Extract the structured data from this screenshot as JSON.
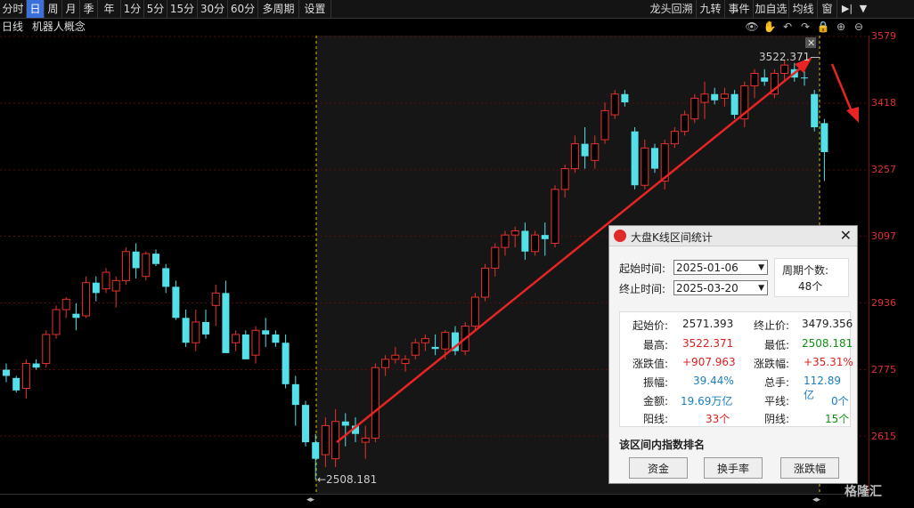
{
  "toolbar": {
    "periods": [
      "分时",
      "日",
      "周",
      "月",
      "季",
      "年",
      "1分",
      "5分",
      "15分",
      "30分",
      "60分",
      "多周期",
      "设置"
    ],
    "right_items": [
      "龙头回溯",
      "九转",
      "事件",
      "加自选",
      "均线",
      "窗"
    ]
  },
  "info": {
    "period": "日线",
    "name": "机器人概念"
  },
  "yaxis": {
    "labels": [
      "3579",
      "3418",
      "3257",
      "3097",
      "2936",
      "2775",
      "2615"
    ]
  },
  "markers": {
    "high": "3522.371",
    "low": "2508.181"
  },
  "stats": {
    "title": "大盘K线区间统计",
    "start_label": "起始时间:",
    "start_value": "2025-01-06",
    "end_label": "终止时间:",
    "end_value": "2025-03-20",
    "cycles_label": "周期个数:",
    "cycles_value": "48个",
    "open_label": "起始价:",
    "open_value": "2571.393",
    "close_label": "终止价:",
    "close_value": "3479.356",
    "high_label": "最高:",
    "high_value": "3522.371",
    "low_label": "最低:",
    "low_value": "2508.181",
    "chg_label": "涨跌值:",
    "chg_value": "+907.963",
    "pct_label": "涨跌幅:",
    "pct_value": "+35.31%",
    "amp_label": "振幅:",
    "amp_value": "39.44%",
    "vol_label": "总手:",
    "vol_value": "112.89亿",
    "amt_label": "金额:",
    "amt_value": "19.69万亿",
    "flat_label": "平线:",
    "flat_value": "0个",
    "up_label": "阳线:",
    "up_value": "33个",
    "down_label": "阴线:",
    "down_value": "15个",
    "rank_label": "该区间内指数排名",
    "buttons": [
      "资金",
      "换手率",
      "涨跌幅"
    ]
  },
  "brand": "格隆汇",
  "colors": {
    "up": "#e8322a",
    "down": "#54e0e8",
    "grid": "#5a0d0d",
    "line": "#e82424"
  },
  "candles": [
    [
      2775,
      2790,
      2745,
      2760
    ],
    [
      2755,
      2760,
      2720,
      2725
    ],
    [
      2730,
      2800,
      2705,
      2790
    ],
    [
      2790,
      2800,
      2775,
      2780
    ],
    [
      2790,
      2870,
      2780,
      2860
    ],
    [
      2860,
      2930,
      2850,
      2920
    ],
    [
      2920,
      2950,
      2900,
      2945
    ],
    [
      2910,
      2935,
      2870,
      2900
    ],
    [
      2905,
      3000,
      2900,
      2985
    ],
    [
      2985,
      3000,
      2940,
      2960
    ],
    [
      2970,
      3020,
      2960,
      3010
    ],
    [
      2965,
      3000,
      2925,
      2990
    ],
    [
      2990,
      3070,
      2980,
      3060
    ],
    [
      3060,
      3080,
      2995,
      3020
    ],
    [
      3000,
      3060,
      2990,
      3055
    ],
    [
      3055,
      3065,
      3025,
      3030
    ],
    [
      3020,
      3030,
      2960,
      2975
    ],
    [
      2975,
      2990,
      2895,
      2900
    ],
    [
      2900,
      2920,
      2830,
      2840
    ],
    [
      2840,
      2920,
      2820,
      2890
    ],
    [
      2890,
      2920,
      2850,
      2860
    ],
    [
      2930,
      2980,
      2880,
      2960
    ],
    [
      2960,
      2990,
      2820,
      2815
    ],
    [
      2840,
      2870,
      2820,
      2860
    ],
    [
      2860,
      2870,
      2800,
      2800
    ],
    [
      2810,
      2880,
      2790,
      2870
    ],
    [
      2870,
      2900,
      2830,
      2860
    ],
    [
      2860,
      2870,
      2830,
      2840
    ],
    [
      2840,
      2860,
      2730,
      2740
    ],
    [
      2740,
      2760,
      2640,
      2690
    ],
    [
      2690,
      2700,
      2590,
      2600
    ],
    [
      2600,
      2620,
      2510,
      2560
    ],
    [
      2570,
      2660,
      2540,
      2640
    ],
    [
      2560,
      2680,
      2540,
      2650
    ],
    [
      2650,
      2670,
      2590,
      2640
    ],
    [
      2640,
      2660,
      2600,
      2620
    ],
    [
      2600,
      2640,
      2560,
      2610
    ],
    [
      2610,
      2790,
      2600,
      2780
    ],
    [
      2780,
      2810,
      2760,
      2800
    ],
    [
      2800,
      2830,
      2790,
      2810
    ],
    [
      2790,
      2810,
      2770,
      2800
    ],
    [
      2810,
      2850,
      2800,
      2840
    ],
    [
      2840,
      2860,
      2820,
      2850
    ],
    [
      2830,
      2860,
      2810,
      2825
    ],
    [
      2825,
      2870,
      2800,
      2865
    ],
    [
      2865,
      2880,
      2810,
      2820
    ],
    [
      2820,
      2890,
      2810,
      2880
    ],
    [
      2880,
      2960,
      2870,
      2950
    ],
    [
      2950,
      3030,
      2940,
      3020
    ],
    [
      3020,
      3080,
      3000,
      3070
    ],
    [
      3070,
      3110,
      3050,
      3100
    ],
    [
      3100,
      3120,
      3070,
      3110
    ],
    [
      3110,
      3130,
      3040,
      3060
    ],
    [
      3060,
      3110,
      3050,
      3100
    ],
    [
      3100,
      3130,
      3050,
      3090
    ],
    [
      3080,
      3220,
      3070,
      3210
    ],
    [
      3210,
      3270,
      3190,
      3260
    ],
    [
      3260,
      3340,
      3250,
      3320
    ],
    [
      3320,
      3360,
      3260,
      3290
    ],
    [
      3280,
      3340,
      3260,
      3320
    ],
    [
      3330,
      3420,
      3320,
      3400
    ],
    [
      3390,
      3450,
      3380,
      3440
    ],
    [
      3440,
      3450,
      3410,
      3420
    ],
    [
      3350,
      3360,
      3210,
      3220
    ],
    [
      3220,
      3330,
      3210,
      3310
    ],
    [
      3310,
      3320,
      3250,
      3260
    ],
    [
      3230,
      3330,
      3210,
      3320
    ],
    [
      3320,
      3360,
      3310,
      3350
    ],
    [
      3350,
      3400,
      3340,
      3390
    ],
    [
      3380,
      3440,
      3370,
      3430
    ],
    [
      3420,
      3470,
      3380,
      3440
    ],
    [
      3440,
      3455,
      3415,
      3425
    ],
    [
      3430,
      3455,
      3410,
      3440
    ],
    [
      3440,
      3450,
      3380,
      3390
    ],
    [
      3380,
      3470,
      3360,
      3460
    ],
    [
      3460,
      3500,
      3430,
      3490
    ],
    [
      3480,
      3500,
      3460,
      3470
    ],
    [
      3440,
      3500,
      3430,
      3490
    ],
    [
      3490,
      3522,
      3470,
      3510
    ],
    [
      3500,
      3515,
      3470,
      3480
    ],
    [
      3480,
      3495,
      3460,
      3479
    ],
    [
      3440,
      3450,
      3350,
      3360
    ],
    [
      3370,
      3380,
      3230,
      3300
    ]
  ]
}
